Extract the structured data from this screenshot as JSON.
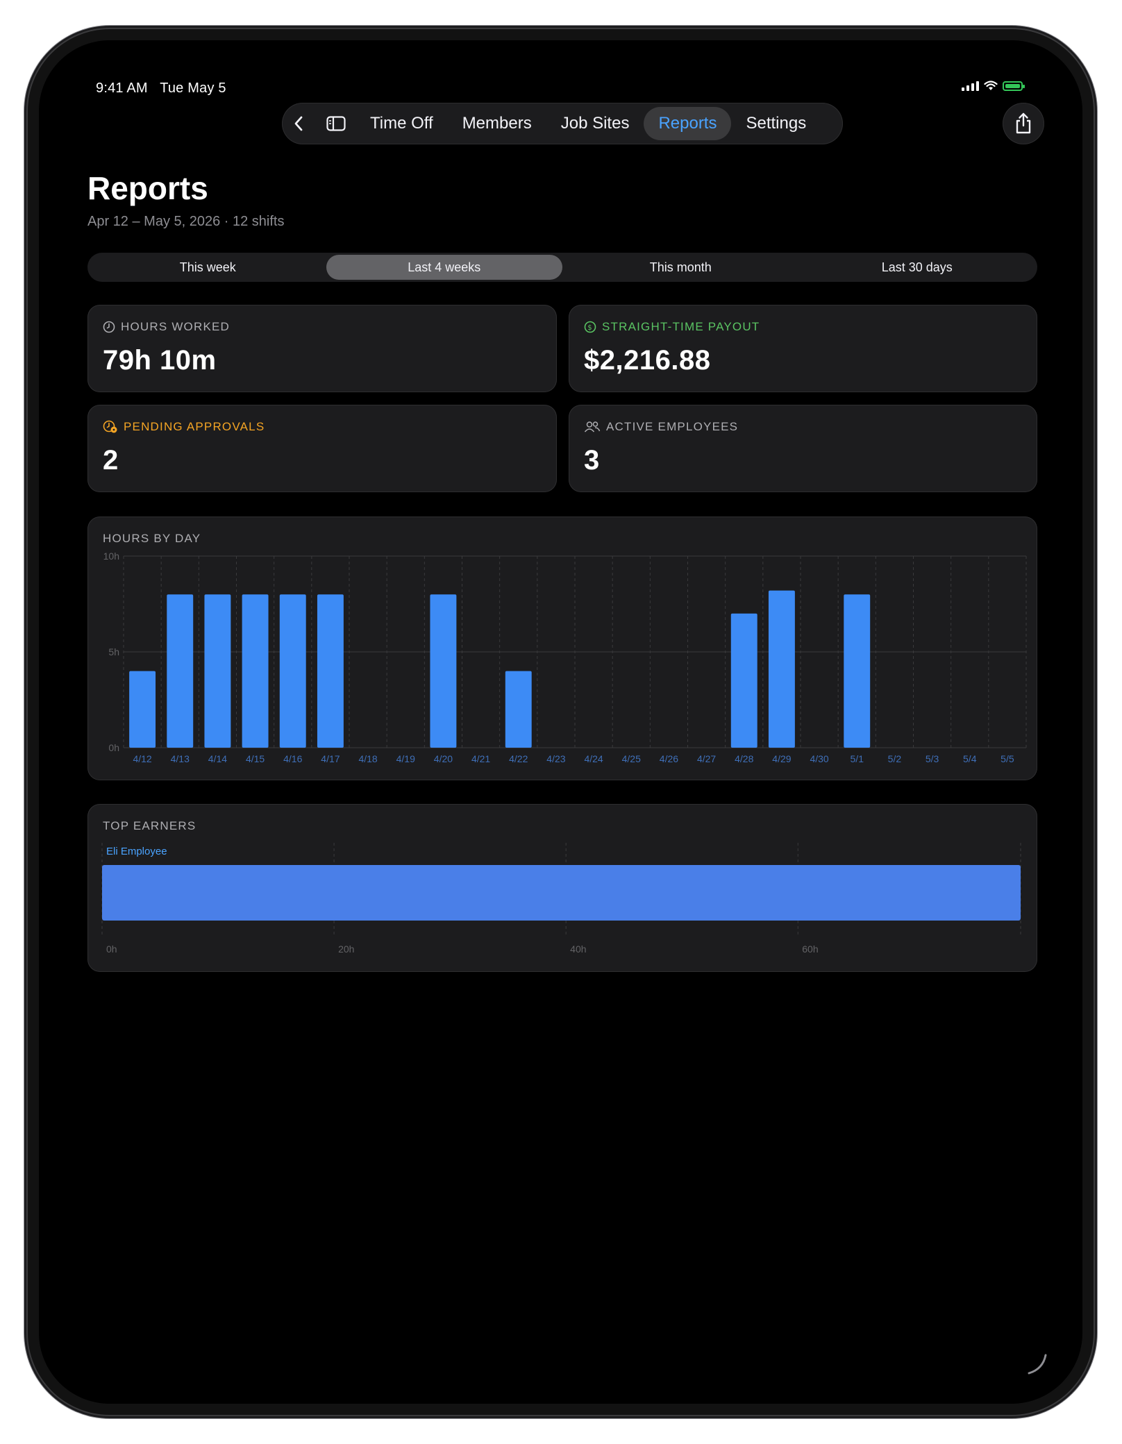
{
  "status_bar": {
    "time": "9:41 AM",
    "date": "Tue May 5"
  },
  "nav": {
    "back_icon": "chevron-left-icon",
    "sidebar_icon": "sidebar-toggle-icon",
    "tabs": [
      {
        "label": "Time Off",
        "active": false
      },
      {
        "label": "Members",
        "active": false
      },
      {
        "label": "Job Sites",
        "active": false
      },
      {
        "label": "Reports",
        "active": true
      },
      {
        "label": "Settings",
        "active": false
      }
    ],
    "share_icon": "share-icon"
  },
  "header": {
    "title": "Reports",
    "subtitle": "Apr 12 – May 5, 2026 · 12 shifts"
  },
  "range_filter": {
    "options": [
      "This week",
      "Last 4 weeks",
      "This month",
      "Last 30 days"
    ],
    "selected": "Last 4 weeks"
  },
  "stats": {
    "hours_worked": {
      "label": "HOURS WORKED",
      "value": "79h 10m",
      "icon": "clock-icon",
      "color": "#aeaeb2"
    },
    "payout": {
      "label": "STRAIGHT-TIME PAYOUT",
      "value": "$2,216.88",
      "icon": "dollar-circle-icon",
      "color": "#5ac463"
    },
    "pending": {
      "label": "PENDING APPROVALS",
      "value": "2",
      "icon": "pending-clock-icon",
      "color": "#f5a524"
    },
    "employees": {
      "label": "ACTIVE EMPLOYEES",
      "value": "3",
      "icon": "people-icon",
      "color": "#aeaeb2"
    }
  },
  "colors": {
    "accent": "#4aa3ff",
    "bar": "#3d8bf5",
    "earner_bar": "#4a7fe8"
  },
  "chart_data": [
    {
      "type": "bar",
      "title": "HOURS BY DAY",
      "categories": [
        "4/12",
        "4/13",
        "4/14",
        "4/15",
        "4/16",
        "4/17",
        "4/18",
        "4/19",
        "4/20",
        "4/21",
        "4/22",
        "4/23",
        "4/24",
        "4/25",
        "4/26",
        "4/27",
        "4/28",
        "4/29",
        "4/30",
        "5/1",
        "5/2",
        "5/3",
        "5/4",
        "5/5"
      ],
      "values": [
        4,
        8,
        8,
        8,
        8,
        8,
        0,
        0,
        8,
        0,
        4,
        0,
        0,
        0,
        0,
        0,
        7,
        8.2,
        0,
        8,
        0,
        0,
        0,
        0
      ],
      "yticks": [
        "0h",
        "5h",
        "10h"
      ],
      "ylim": [
        0,
        10
      ],
      "grid": true
    },
    {
      "type": "bar",
      "orientation": "horizontal",
      "title": "TOP EARNERS",
      "categories": [
        "Eli Employee"
      ],
      "values": [
        79.2
      ],
      "xticks": [
        "0h",
        "20h",
        "40h",
        "60h"
      ],
      "xlim": [
        0,
        79.2
      ],
      "grid": true
    }
  ]
}
